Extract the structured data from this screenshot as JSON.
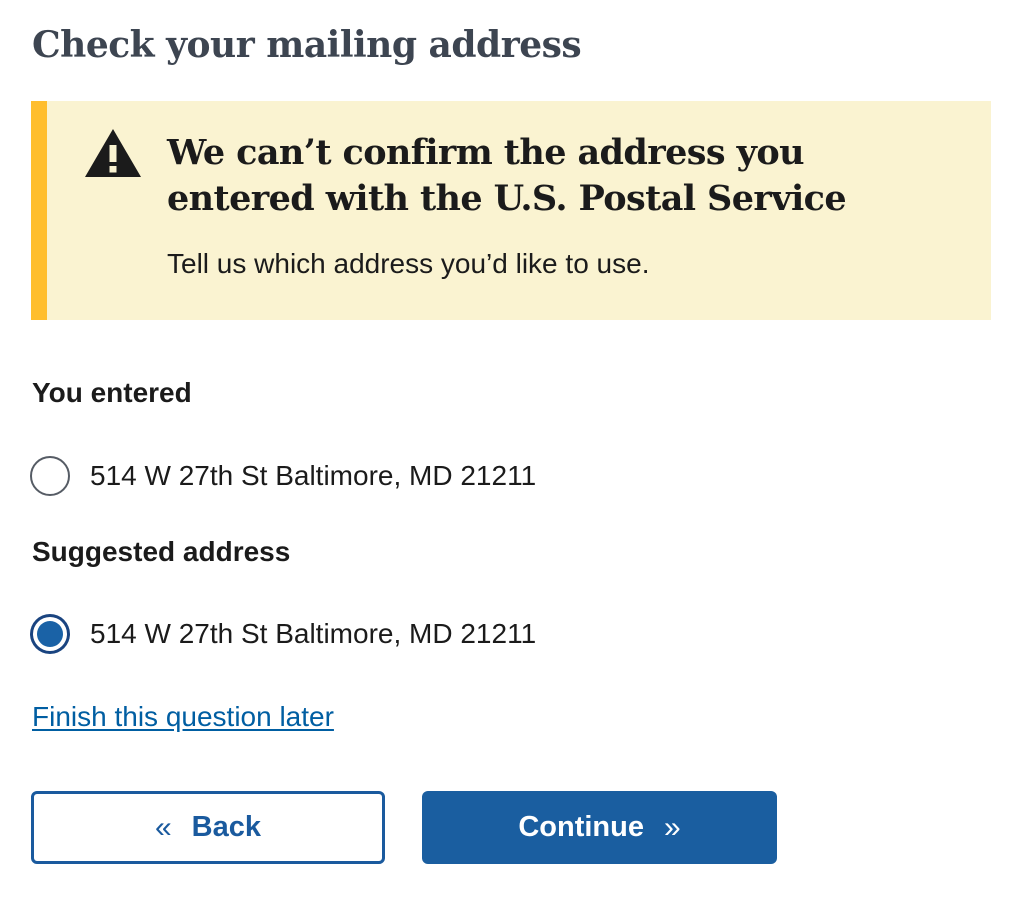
{
  "page": {
    "title": "Check your mailing address"
  },
  "alert": {
    "heading": "We can’t confirm the address you entered with the U.S. Postal Service",
    "body": "Tell us which address you’d like to use.",
    "icon": "warning-icon",
    "colors": {
      "background": "#faf3d1",
      "accent": "#ffbe2e"
    }
  },
  "address_options": {
    "entered": {
      "label": "You entered",
      "address": "514 W 27th St Baltimore, MD 21211",
      "selected": false
    },
    "suggested": {
      "label": "Suggested address",
      "address": "514 W 27th St Baltimore, MD 21211",
      "selected": true
    }
  },
  "links": {
    "finish_later": "Finish this question later"
  },
  "buttons": {
    "back": {
      "label": "Back",
      "icon": "chevron-double-left-icon",
      "glyph": "«"
    },
    "continue": {
      "label": "Continue",
      "icon": "chevron-double-right-icon",
      "glyph": "»"
    },
    "colors": {
      "primary": "#1a5ea0"
    }
  }
}
